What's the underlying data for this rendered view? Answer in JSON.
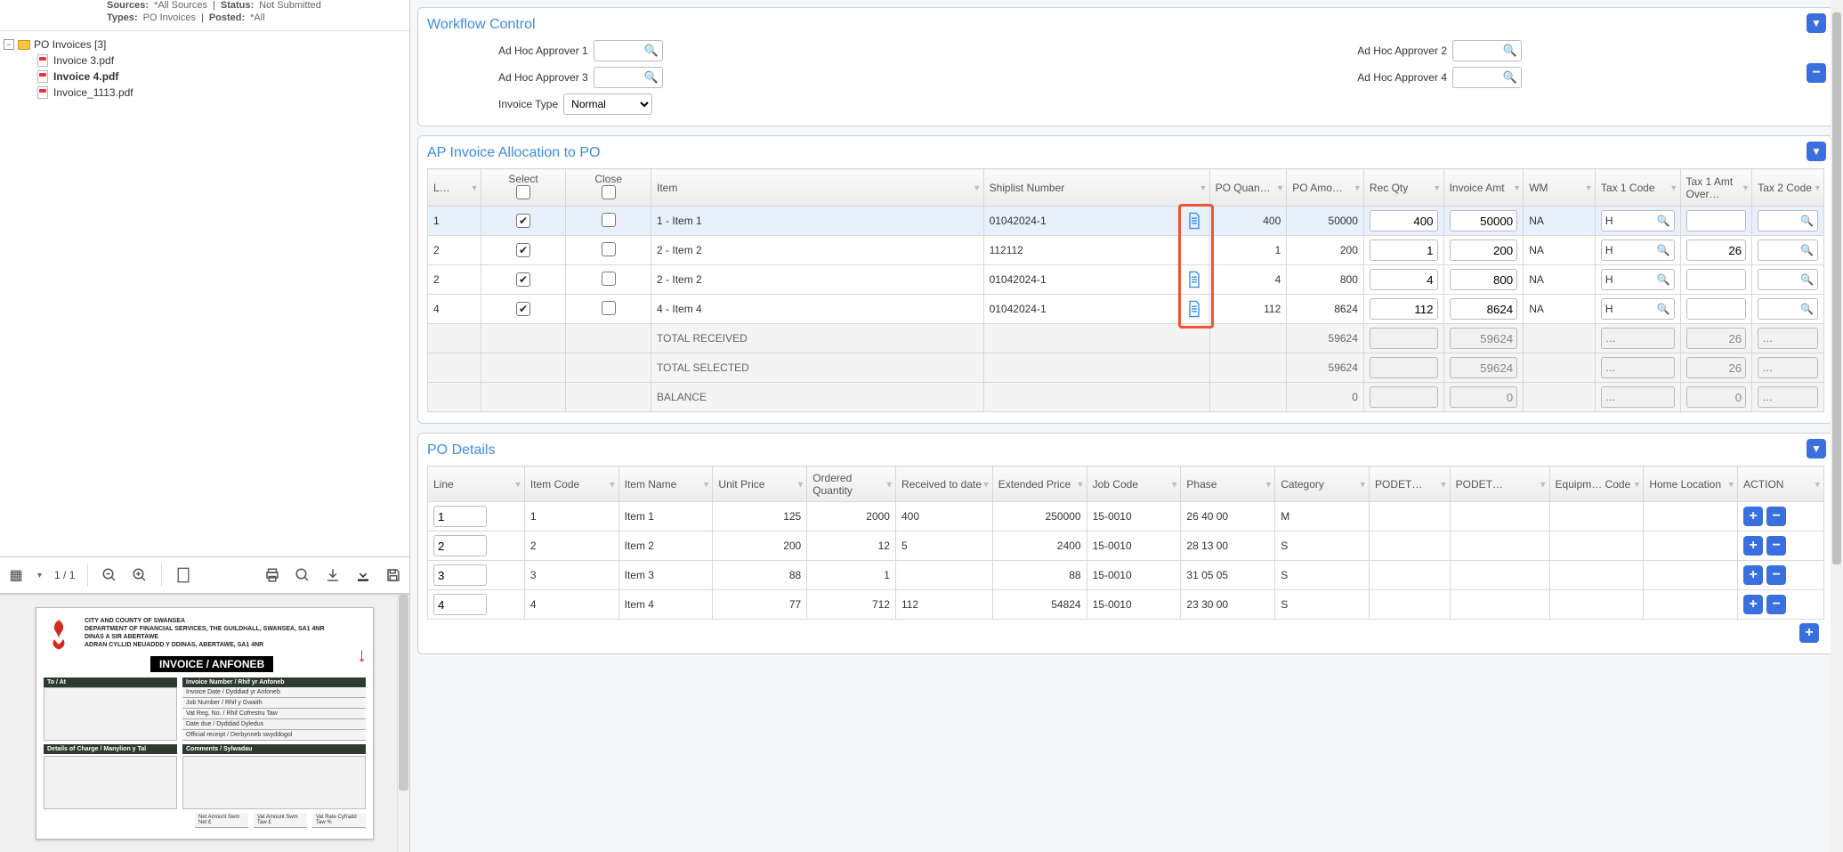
{
  "filters": {
    "sources_label": "Sources:",
    "sources_value": "*All Sources",
    "status_label": "Status:",
    "status_value": "Not Submitted",
    "types_label": "Types:",
    "types_value": "PO Invoices",
    "posted_label": "Posted:",
    "posted_value": "*All"
  },
  "tree": {
    "folder_label": "PO Invoices [3]",
    "files": [
      {
        "name": "Invoice 3.pdf",
        "selected": false
      },
      {
        "name": "Invoice 4.pdf",
        "selected": true
      },
      {
        "name": "Invoice_1113.pdf",
        "selected": false
      }
    ]
  },
  "viewer": {
    "pages": "1 / 1"
  },
  "doc": {
    "addr1": "CITY AND COUNTY OF SWANSEA",
    "addr2": "DEPARTMENT OF FINANCIAL SERVICES, THE GUILDHALL, SWANSEA, SA1 4NR",
    "addr3": "DINAS A SIR ABERTAWE",
    "addr4": "ADRAN CYLLID NEUADDD Y DDINAS, ABERTAWE, SA1 4NR",
    "title": "INVOICE / ANFONEB",
    "to_at": "To / At",
    "inv_num": "Invoice Number / Rhif yr Anfoneb",
    "inv_date": "Invoice Date / Dyddiad yr Anfoneb",
    "job_num": "Job Number / Rhif y Gwaith",
    "vat_reg": "Vat Reg. No. / Rhif Cofrestru Taw",
    "date_due": "Date due / Dyddiad Dyledus",
    "receipt": "Official receipt / Derbynneb swyddogol",
    "details": "Details of Charge / Manylion y Tal",
    "comments": "Comments / Sylwadau",
    "net": "Net Amount Swm Net   £",
    "vat_amt": "Vat Amount Swm Taw  £",
    "vat_rate": "Vat Rate Cyfradd Taw %"
  },
  "workflow": {
    "title": "Workflow Control",
    "ap1": "Ad Hoc Approver 1",
    "ap2": "Ad Hoc Approver 2",
    "ap3": "Ad Hoc Approver 3",
    "ap4": "Ad Hoc Approver 4",
    "itype_label": "Invoice Type",
    "itype_value": "Normal"
  },
  "alloc": {
    "title": "AP Invoice Allocation to PO",
    "headers": {
      "l": "L…",
      "select": "Select",
      "close": "Close",
      "item": "Item",
      "shiplist": "Shiplist Number",
      "poq": "PO Quan…",
      "poa": "PO Amo…",
      "recqty": "Rec Qty",
      "invamt": "Invoice Amt",
      "wm": "WM",
      "t1": "Tax 1 Code",
      "t1o": "Tax 1 Amt Over…",
      "t2": "Tax 2 Code"
    },
    "rows": [
      {
        "l": "1",
        "select": true,
        "close": false,
        "item": "1 - Item 1",
        "ship": "01042024-1",
        "doc": true,
        "poq": "400",
        "poa": "50000",
        "recqty": "400",
        "invamt": "50000",
        "wm": "NA",
        "t1": "H",
        "t1o": "",
        "t2": ""
      },
      {
        "l": "2",
        "select": true,
        "close": false,
        "item": "2 - Item 2",
        "ship": "112112",
        "doc": false,
        "poq": "1",
        "poa": "200",
        "recqty": "1",
        "invamt": "200",
        "wm": "NA",
        "t1": "H",
        "t1o": "26",
        "t2": ""
      },
      {
        "l": "2",
        "select": true,
        "close": false,
        "item": "2 - Item 2",
        "ship": "01042024-1",
        "doc": true,
        "poq": "4",
        "poa": "800",
        "recqty": "4",
        "invamt": "800",
        "wm": "NA",
        "t1": "H",
        "t1o": "",
        "t2": ""
      },
      {
        "l": "4",
        "select": true,
        "close": false,
        "item": "4 - Item 4",
        "ship": "01042024-1",
        "doc": true,
        "poq": "112",
        "poa": "8624",
        "recqty": "112",
        "invamt": "8624",
        "wm": "NA",
        "t1": "H",
        "t1o": "",
        "t2": ""
      }
    ],
    "footers": {
      "received": "TOTAL RECEIVED",
      "received_poa": "59624",
      "received_inv": "59624",
      "received_t1o": "26",
      "selected": "TOTAL SELECTED",
      "selected_poa": "59624",
      "selected_inv": "59624",
      "selected_t1o": "26",
      "balance": "BALANCE",
      "balance_poa": "0",
      "balance_inv": "0",
      "balance_t1o": "0"
    }
  },
  "po": {
    "title": "PO Details",
    "headers": {
      "line": "Line",
      "code": "Item Code",
      "name": "Item Name",
      "up": "Unit Price",
      "oq": "Ordered Quantity",
      "rd": "Received to date",
      "ep": "Extended Price",
      "jc": "Job Code",
      "ph": "Phase",
      "cat": "Category",
      "pd1": "PODET…",
      "pd2": "PODET…",
      "eq": "Equipm… Code",
      "hl": "Home Location",
      "act": "ACTION"
    },
    "rows": [
      {
        "line": "1",
        "code": "1",
        "name": "Item 1",
        "up": "125",
        "oq": "2000",
        "rd": "400",
        "ep": "250000",
        "jc": "15-0010",
        "ph": "26 40 00",
        "cat": "M"
      },
      {
        "line": "2",
        "code": "2",
        "name": "Item 2",
        "up": "200",
        "oq": "12",
        "rd": "5",
        "ep": "2400",
        "jc": "15-0010",
        "ph": "28 13 00",
        "cat": "S"
      },
      {
        "line": "3",
        "code": "3",
        "name": "Item 3",
        "up": "88",
        "oq": "1",
        "rd": "",
        "ep": "88",
        "jc": "15-0010",
        "ph": "31 05 05",
        "cat": "S"
      },
      {
        "line": "4",
        "code": "4",
        "name": "Item 4",
        "up": "77",
        "oq": "712",
        "rd": "112",
        "ep": "54824",
        "jc": "15-0010",
        "ph": "23 30 00",
        "cat": "S"
      }
    ]
  },
  "glyphs": {
    "dots": "…"
  }
}
